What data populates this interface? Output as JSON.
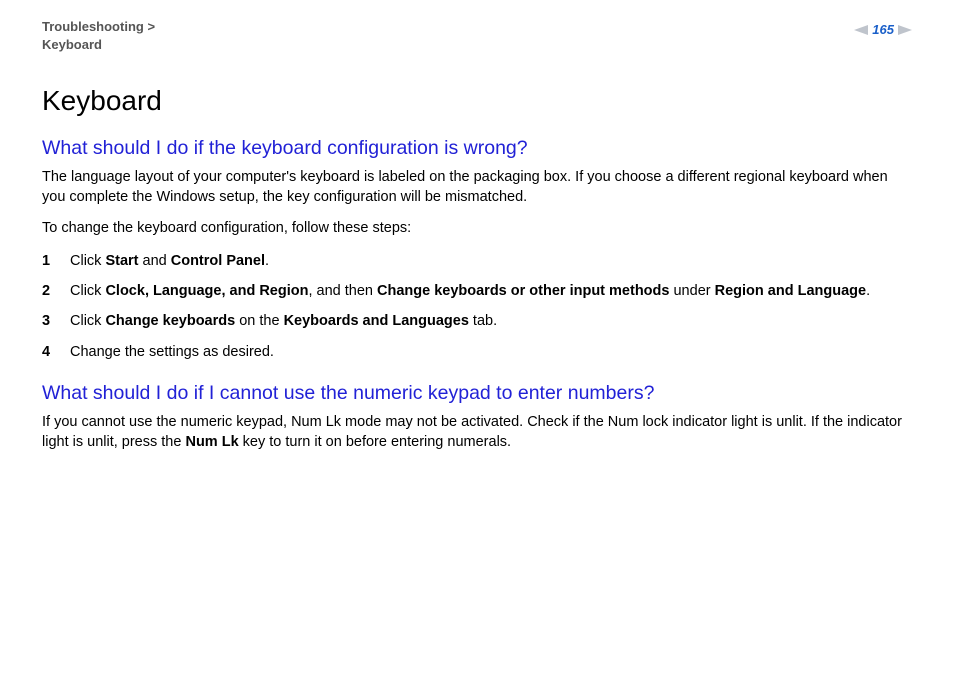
{
  "header": {
    "breadcrumb_section": "Troubleshooting",
    "breadcrumb_sep": " >",
    "breadcrumb_page": "Keyboard",
    "page_number": "165"
  },
  "content": {
    "title": "Keyboard",
    "section1": {
      "heading": "What should I do if the keyboard configuration is wrong?",
      "para1": "The language layout of your computer's keyboard is labeled on the packaging box. If you choose a different regional keyboard when you complete the Windows setup, the key configuration will be mismatched.",
      "para2": "To change the keyboard configuration, follow these steps:",
      "steps": {
        "s1": {
          "a": "Click ",
          "b1": "Start",
          "c": " and ",
          "b2": "Control Panel",
          "d": "."
        },
        "s2": {
          "a": "Click ",
          "b1": "Clock, Language, and Region",
          "c": ", and then ",
          "b2": "Change keyboards or other input methods",
          "d": " under ",
          "b3": "Region and Language",
          "e": "."
        },
        "s3": {
          "a": "Click ",
          "b1": "Change keyboards",
          "c": " on the ",
          "b2": "Keyboards and Languages",
          "d": " tab."
        },
        "s4": {
          "a": "Change the settings as desired."
        }
      }
    },
    "section2": {
      "heading": "What should I do if I cannot use the numeric keypad to enter numbers?",
      "para": {
        "a": "If you cannot use the numeric keypad, Num Lk mode may not be activated. Check if the Num lock indicator light is unlit. If the indicator light is unlit, press the ",
        "b": "Num Lk",
        "c": " key to turn it on before entering numerals."
      }
    }
  }
}
